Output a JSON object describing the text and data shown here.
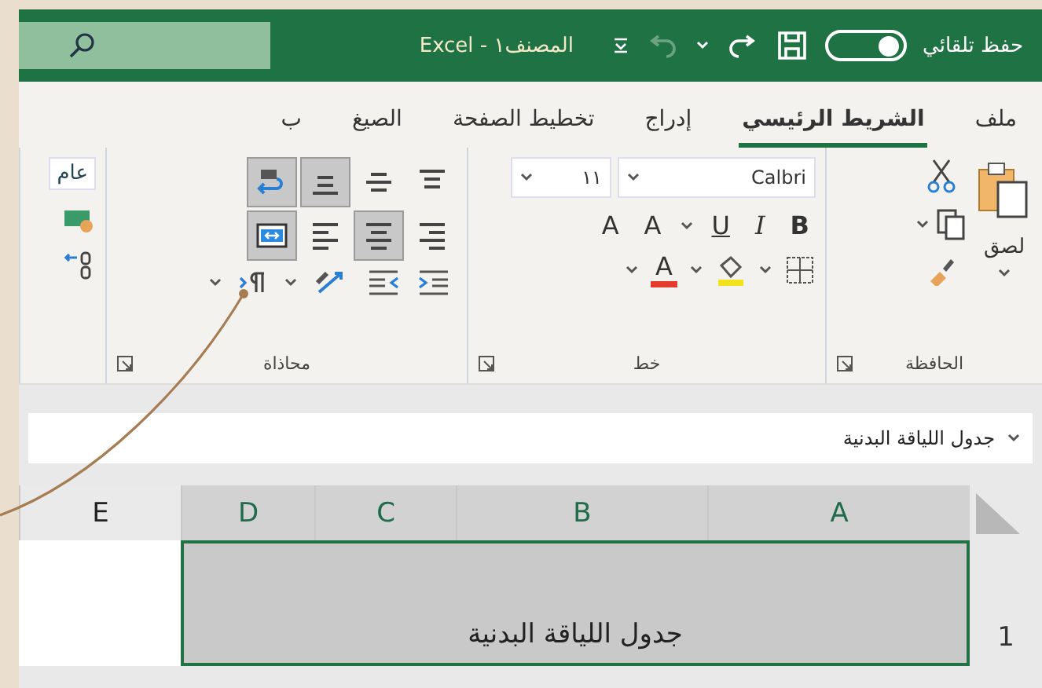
{
  "title_bar": {
    "autosave_label": "حفظ تلقائي",
    "autosave_on": true,
    "title": "المصنف١ - Excel",
    "undo_disabled": true
  },
  "tabs": [
    {
      "label": "ملف",
      "selected": false
    },
    {
      "label": "الشريط الرئيسي",
      "selected": true
    },
    {
      "label": "إدراج",
      "selected": false
    },
    {
      "label": "تخطيط الصفحة",
      "selected": false
    },
    {
      "label": "الصيغ",
      "selected": false
    },
    {
      "label": "ب",
      "selected": false
    }
  ],
  "clipboard": {
    "paste_label": "لصق",
    "group_label": "الحافظة"
  },
  "font": {
    "font_name": "Calbri",
    "font_size": "١١",
    "bold": "B",
    "italic": "I",
    "underline": "U",
    "grow": "A",
    "shrink": "A",
    "font_color": "A",
    "group_label": "خط"
  },
  "alignment": {
    "group_label": "محاذاة",
    "buttons": [
      {
        "kind": "top-align",
        "selected": false
      },
      {
        "kind": "middle-align",
        "selected": false
      },
      {
        "kind": "bottom-align",
        "selected": true
      },
      {
        "kind": "wrap-text",
        "selected": true
      },
      {
        "kind": "right-align",
        "selected": false
      },
      {
        "kind": "center-align",
        "selected": true
      },
      {
        "kind": "left-align",
        "selected": false
      },
      {
        "kind": "merge",
        "selected": true
      }
    ]
  },
  "number": {
    "format": "عام"
  },
  "formula_bar": {
    "value": "جدول اللياقة البدنية"
  },
  "columns": [
    {
      "label": "A",
      "selected": true
    },
    {
      "label": "B",
      "selected": true
    },
    {
      "label": "C",
      "selected": true
    },
    {
      "label": "D",
      "selected": true
    },
    {
      "label": "E",
      "selected": false
    }
  ],
  "rows": [
    {
      "label": "1",
      "cell": "جدول اللياقة البدنية",
      "selected": true
    }
  ]
}
